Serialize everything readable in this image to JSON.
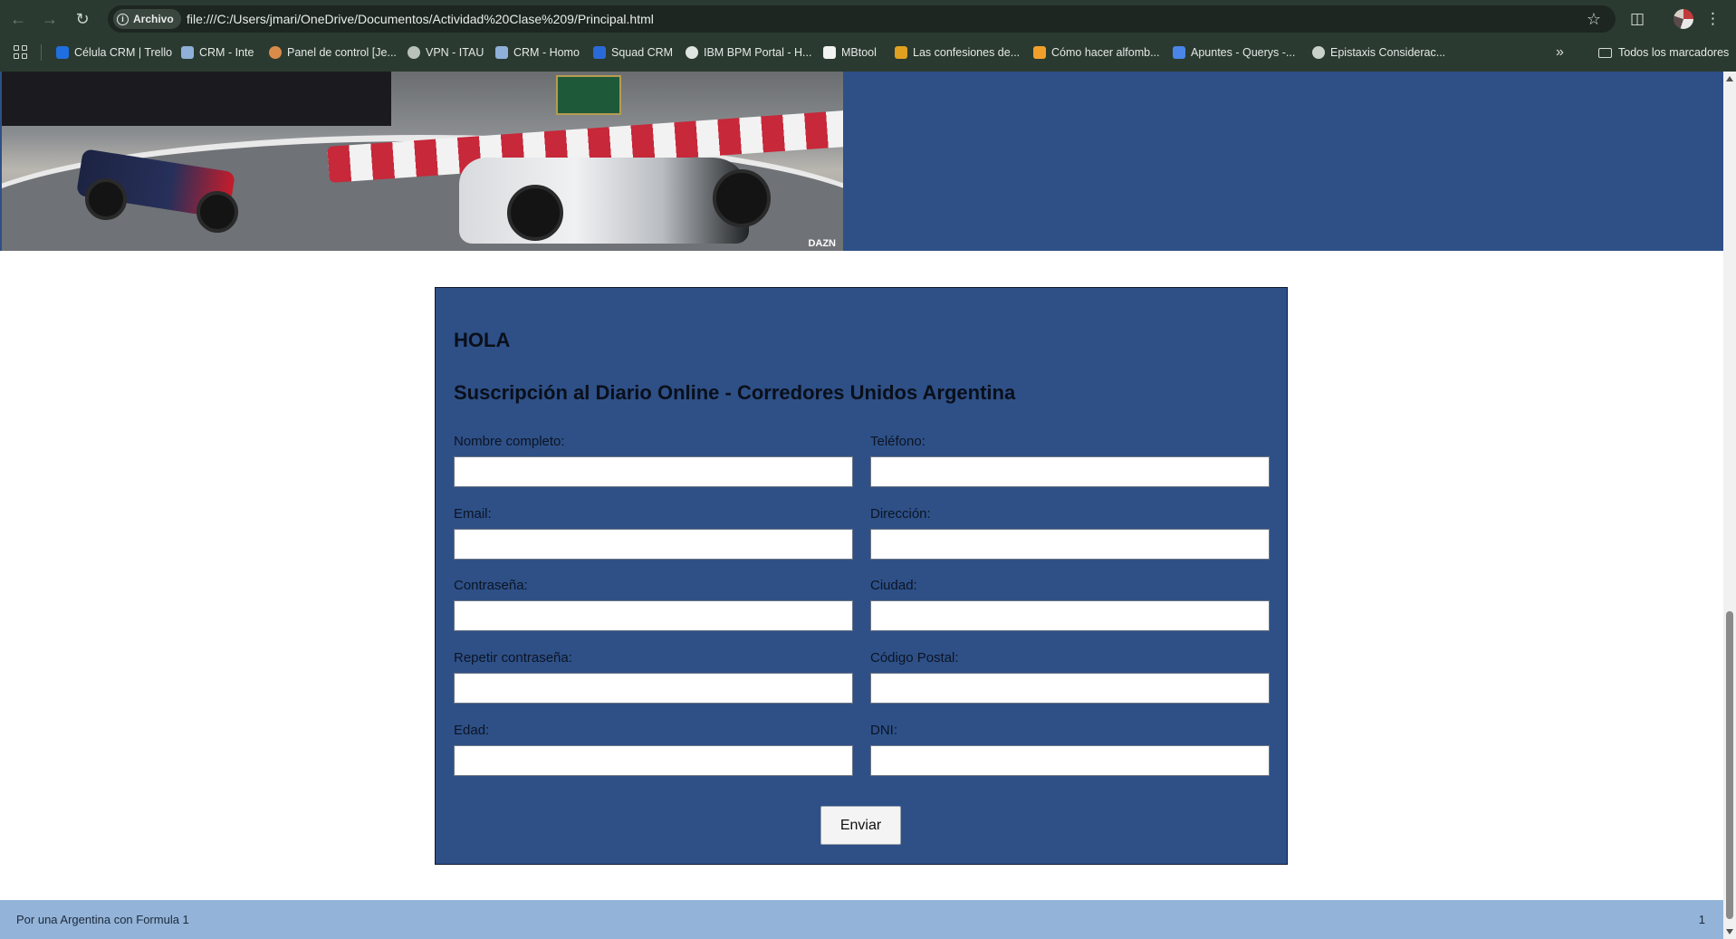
{
  "browser": {
    "site_chip": "Archivo",
    "url": "file:///C:/Users/jmari/OneDrive/Documentos/Actividad%20Clase%209/Principal.html",
    "bookmarks": [
      {
        "label": "Célula CRM | Trello",
        "color": "#1f6fe0"
      },
      {
        "label": "CRM - Inte",
        "color": "#8fb0d8"
      },
      {
        "label": "Panel de control [Je...",
        "color": "#d98c4a"
      },
      {
        "label": "VPN - ITAU",
        "color": "#b8c2bb"
      },
      {
        "label": "CRM - Homo",
        "color": "#8fb0d8"
      },
      {
        "label": "Squad CRM",
        "color": "#2a6ad8"
      },
      {
        "label": "IBM BPM Portal - H...",
        "color": "#dfe6e1"
      },
      {
        "label": "MBtool",
        "color": "#f2f2f2"
      },
      {
        "label": "Las confesiones de...",
        "color": "#e0a020"
      },
      {
        "label": "Cómo hacer alfomb...",
        "color": "#f0a02a"
      },
      {
        "label": "Apuntes - Querys -...",
        "color": "#4a86e8"
      },
      {
        "label": "Epistaxis Considerac...",
        "color": "#c9d1cb"
      }
    ],
    "all_bookmarks": "Todos los marcadores"
  },
  "hero": {
    "watermark": "DAZN"
  },
  "form": {
    "greeting": "HOLA",
    "title": "Suscripción al Diario Online - Corredores Unidos Argentina",
    "left_fields": [
      {
        "label": "Nombre completo:",
        "value": ""
      },
      {
        "label": "Email:",
        "value": ""
      },
      {
        "label": "Contraseña:",
        "value": ""
      },
      {
        "label": "Repetir contraseña:",
        "value": ""
      },
      {
        "label": "Edad:",
        "value": ""
      }
    ],
    "right_fields": [
      {
        "label": "Teléfono:",
        "value": ""
      },
      {
        "label": "Dirección:",
        "value": ""
      },
      {
        "label": "Ciudad:",
        "value": ""
      },
      {
        "label": "Código Postal:",
        "value": ""
      },
      {
        "label": "DNI:",
        "value": ""
      }
    ],
    "submit_label": "Enviar"
  },
  "footer": {
    "text": "Por una Argentina con Formula 1",
    "page_number": "1"
  },
  "colors": {
    "chrome": "#2b3a30",
    "page_accent": "#2e5087",
    "footer": "#93b3d8"
  }
}
